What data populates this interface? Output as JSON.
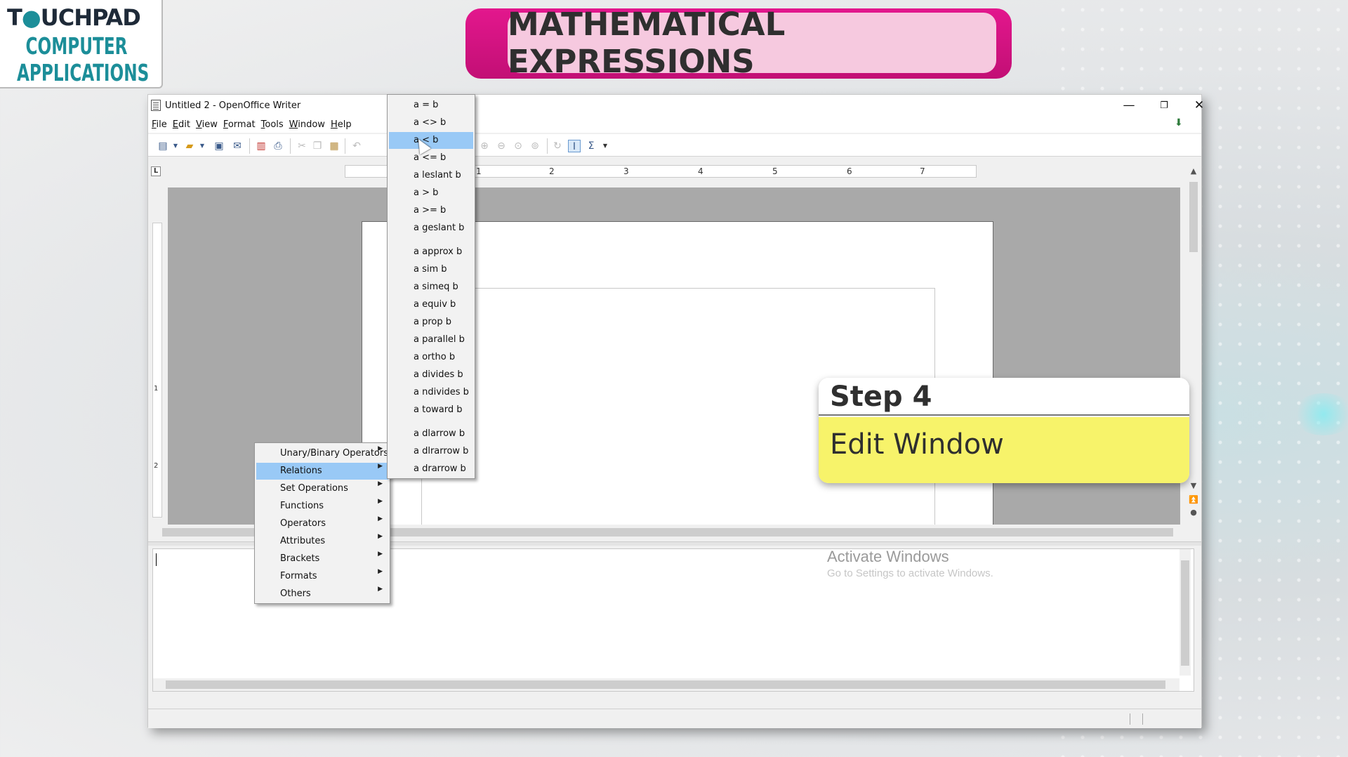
{
  "brand": {
    "line_top_pre": "T",
    "line_top_accent": "●",
    "line_top_post": "UCHPAD",
    "line1": "COMPUTER",
    "line2": "APPLICATIONS"
  },
  "banner": {
    "title": "MATHEMATICAL EXPRESSIONS"
  },
  "window": {
    "title": "Untitled 2 - OpenOffice Writer",
    "controls": {
      "minimize": "—",
      "restore": "❐",
      "close": "✕"
    },
    "menus": [
      "File",
      "Edit",
      "View",
      "Format",
      "Tools",
      "Window",
      "Help"
    ]
  },
  "ruler": {
    "tab_marker": "L",
    "numbers": [
      "1",
      "2",
      "3",
      "4",
      "5",
      "6",
      "7"
    ],
    "vertical_numbers": [
      "1",
      "2"
    ]
  },
  "context_menu": {
    "items": [
      "Unary/Binary Operators",
      "Relations",
      "Set Operations",
      "Functions",
      "Operators",
      "Attributes",
      "Brackets",
      "Formats",
      "Others"
    ],
    "active_index": 1
  },
  "relations_menu": {
    "items": [
      "a = b",
      "a <> b",
      "a < b",
      "a <= b",
      "a leslant b",
      "a > b",
      "a >= b",
      "a geslant b",
      "a approx b",
      "a sim b",
      "a simeq b",
      "a equiv b",
      "a prop b",
      "a parallel b",
      "a ortho b",
      "a divides b",
      "a ndivides b",
      "a toward b",
      "a dlarrow b",
      "a dlrarrow b",
      "a drarrow b"
    ],
    "active_index": 2
  },
  "watermark": {
    "line1": "Activate Windows",
    "line2": "Go to Settings to activate Windows."
  },
  "step": {
    "heading": "Step 4",
    "body": "Edit Window"
  },
  "colors": {
    "banner_outer": "#d3127f",
    "banner_inner": "#f6c9df",
    "step_body": "#f7f36a",
    "menu_highlight": "#99c9f6"
  }
}
